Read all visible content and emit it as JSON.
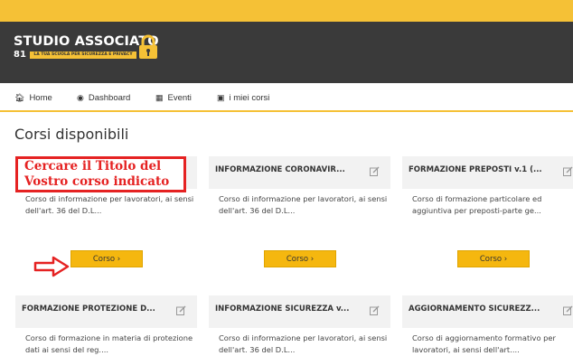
{
  "brand": {
    "name": "STUDIO ASSOCIATO",
    "number": "81",
    "tagline": "LA TUA SCUOLA PER SICUREZZA E PRIVACY"
  },
  "nav": {
    "home": "Home",
    "dashboard": "Dashboard",
    "eventi": "Eventi",
    "corsi": "i miei corsi"
  },
  "page": {
    "title": "Corsi disponibili"
  },
  "annotation": {
    "text": "Cercare il Titolo del Vostro corso indicato",
    "color": "#e52222"
  },
  "courses": [
    {
      "title": "",
      "desc": "Corso di informazione per lavoratori, ai sensi dell'art. 36 del D.L...",
      "button": "Corso ›"
    },
    {
      "title": "INFORMAZIONE CORONAVIR...",
      "desc": "Corso di informazione per lavoratori, ai sensi dell'art. 36 del D.L...",
      "button": "Corso ›"
    },
    {
      "title": "FORMAZIONE PREPOSTI v.1 (...",
      "desc": "Corso di formazione particolare ed aggiuntiva per preposti-parte ge...",
      "button": "Corso ›"
    },
    {
      "title": "FORMAZIONE PROTEZIONE D...",
      "desc": "Corso di formazione in materia di protezione dati ai sensi del reg...."
    },
    {
      "title": "INFORMAZIONE SICUREZZA v...",
      "desc": "Corso di informazione per lavoratori, ai sensi dell'art. 36 del D.L..."
    },
    {
      "title": "AGGIORNAMENTO SICUREZZ...",
      "desc": "Corso di aggiornamento formativo per lavoratori, ai sensi dell'art...."
    }
  ],
  "colors": {
    "accent": "#f5c136",
    "button": "#f5b70f",
    "header_dark": "#3a3a3a",
    "card_header": "#f2f2f2"
  }
}
